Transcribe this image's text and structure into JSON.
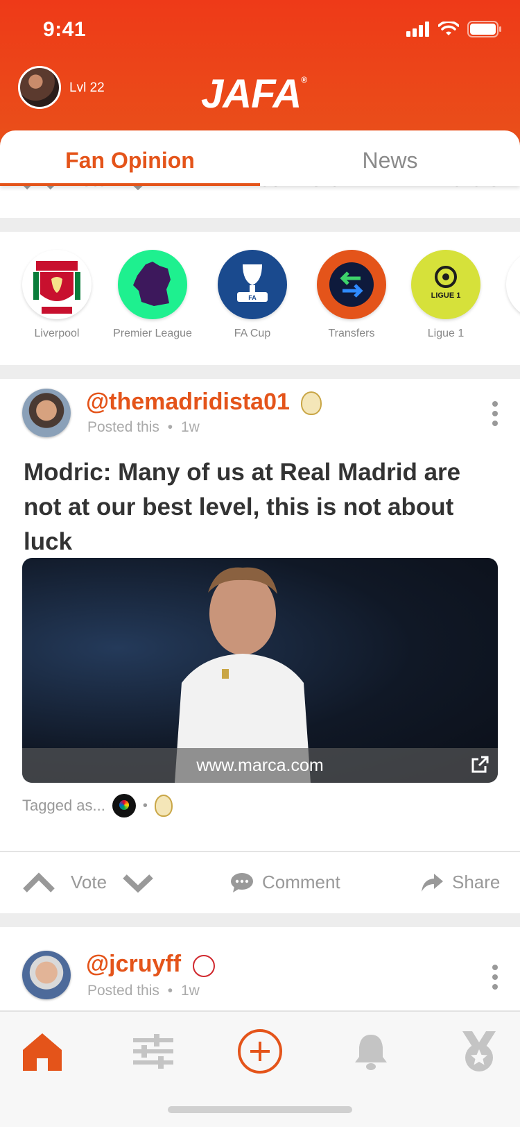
{
  "status_bar": {
    "time": "9:41"
  },
  "header": {
    "level": "Lvl 22",
    "logo": "JAFA",
    "logo_mark": "®"
  },
  "tabs": [
    {
      "label": "Fan Opinion",
      "active": true
    },
    {
      "label": "News",
      "active": false
    }
  ],
  "prev_actions": {
    "vote": "Vote",
    "comment": "Comment",
    "share": "Share"
  },
  "categories": [
    {
      "label": "Liverpool",
      "color": "#ffffff",
      "icon": "liverpool-crest-icon"
    },
    {
      "label": "Premier League",
      "color": "#1ef08f",
      "icon": "premier-league-lion-icon"
    },
    {
      "label": "FA Cup",
      "color": "#1a4a8e",
      "icon": "fa-cup-icon"
    },
    {
      "label": "Transfers",
      "color": "#e4541a",
      "icon": "transfers-arrows-icon"
    },
    {
      "label": "Ligue 1",
      "color": "#d6e13a",
      "icon": "ligue1-logo-icon"
    }
  ],
  "posts": [
    {
      "username": "@themadridista01",
      "posted": "Posted this",
      "time": "1w",
      "title": "Modric: Many of us at Real Madrid are not at our best level, this is not about luck",
      "source": "www.marca.com",
      "tagged_label": "Tagged as...",
      "vote": "Vote",
      "comment": "Comment",
      "share": "Share"
    },
    {
      "username": "@jcruyff",
      "posted": "Posted this",
      "time": "1w"
    }
  ],
  "colors": {
    "accent": "#e4541a",
    "header": "#ee3a18"
  }
}
